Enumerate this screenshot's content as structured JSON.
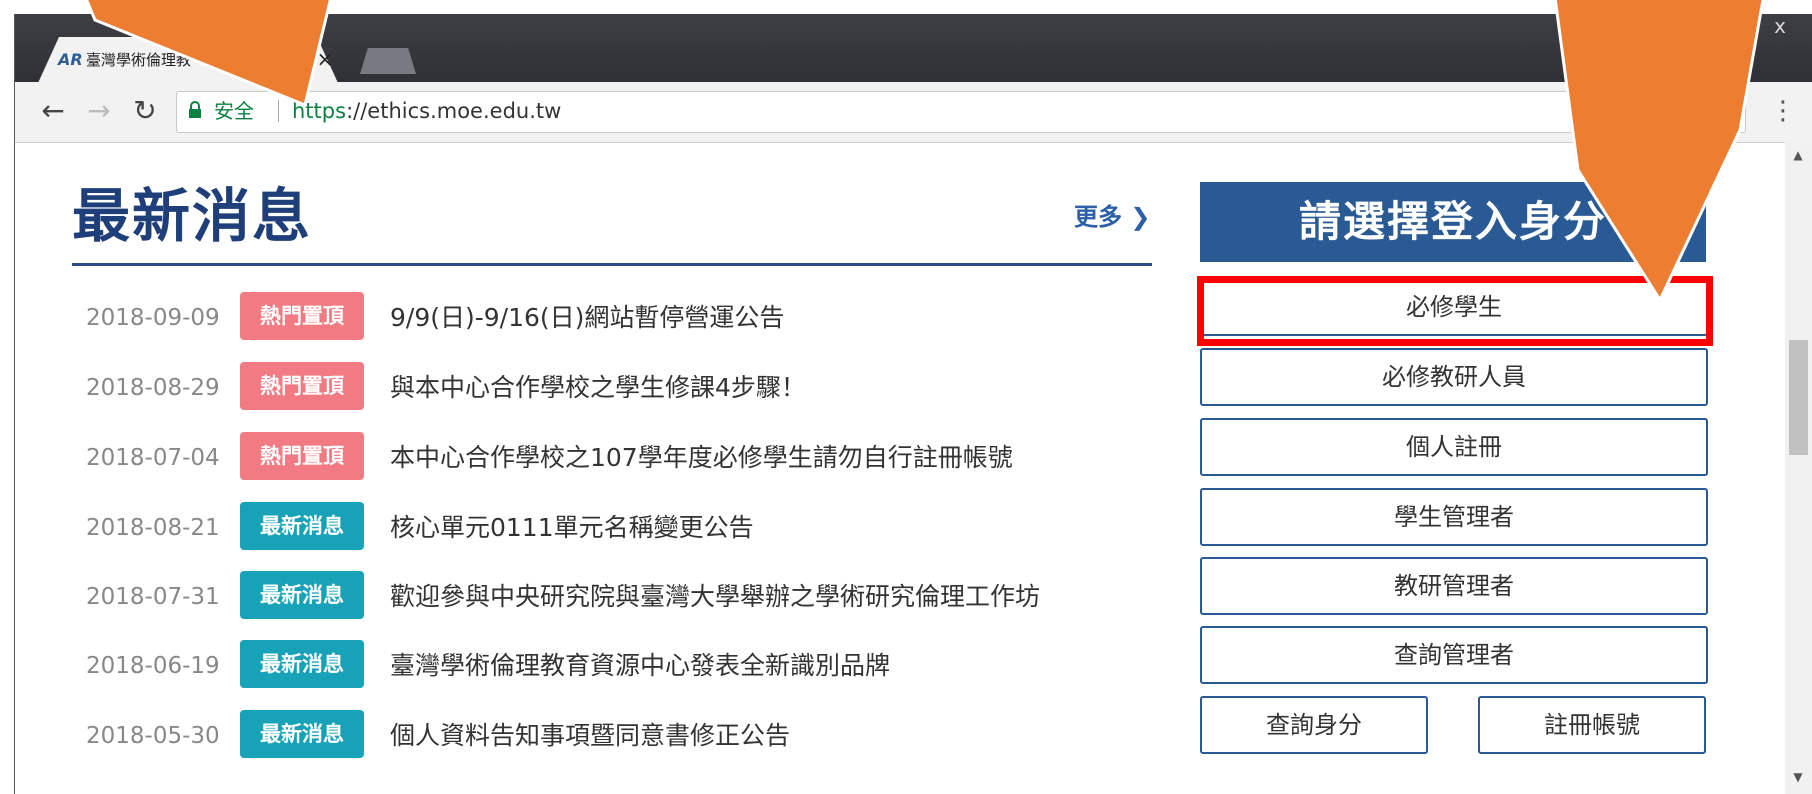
{
  "browser": {
    "tab_title": "臺灣學術倫理教",
    "tab_favicon": "AR",
    "tab_close": "×",
    "window_close": "x",
    "secure_label": "安全",
    "url_scheme": "https",
    "url_rest": "://ethics.moe.edu.tw",
    "nav": {
      "back": "←",
      "forward": "→",
      "reload": "↻",
      "menu": "⋮"
    }
  },
  "news": {
    "title": "最新消息",
    "more_label": "更多",
    "items": [
      {
        "date": "2018-09-09",
        "badge": "熱門置頂",
        "badge_type": "hot",
        "text": "9/9(日)-9/16(日)網站暫停營運公告"
      },
      {
        "date": "2018-08-29",
        "badge": "熱門置頂",
        "badge_type": "hot",
        "text": "與本中心合作學校之學生修課4步驟！"
      },
      {
        "date": "2018-07-04",
        "badge": "熱門置頂",
        "badge_type": "hot",
        "text": "本中心合作學校之107學年度必修學生請勿自行註冊帳號"
      },
      {
        "date": "2018-08-21",
        "badge": "最新消息",
        "badge_type": "news",
        "text": "核心單元0111單元名稱變更公告"
      },
      {
        "date": "2018-07-31",
        "badge": "最新消息",
        "badge_type": "news",
        "text": "歡迎參與中央研究院與臺灣大學舉辦之學術研究倫理工作坊"
      },
      {
        "date": "2018-06-19",
        "badge": "最新消息",
        "badge_type": "news",
        "text": "臺灣學術倫理教育資源中心發表全新識別品牌"
      },
      {
        "date": "2018-05-30",
        "badge": "最新消息",
        "badge_type": "news",
        "text": "個人資料告知事項暨同意書修正公告"
      }
    ]
  },
  "login": {
    "header": "請選擇登入身分",
    "buttons": [
      "必修學生",
      "必修教研人員",
      "個人註冊",
      "學生管理者",
      "教研管理者",
      "查詢管理者"
    ],
    "query_identity": "查詢身分",
    "register_account": "註冊帳號"
  },
  "colors": {
    "hot_badge": "#f27b83",
    "news_badge": "#17a2b8",
    "brand_blue": "#2a5a94",
    "highlight": "#ff0000",
    "arrow": "#ed7d31"
  }
}
